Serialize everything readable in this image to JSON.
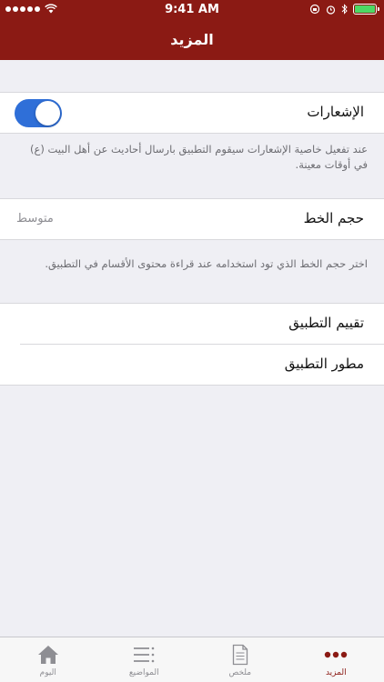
{
  "status_bar": {
    "time": "9:41 AM",
    "battery_level": 1.0,
    "icons": [
      "signal-dots-icon",
      "wifi-icon",
      "orientation-lock-icon",
      "alarm-icon",
      "bluetooth-icon",
      "battery-icon"
    ]
  },
  "nav": {
    "title": "المزيد"
  },
  "notifications": {
    "label": "الإشعارات",
    "enabled": true,
    "note": "عند تفعيل خاصية الإشعارات سيقوم التطبيق بارسال أحاديث عن أهل البيت (ع) في أوقات معينة."
  },
  "font_size": {
    "label": "حجم الخط",
    "value": "متوسط",
    "note": "اختر حجم الخط الذي تود استخدامه عند قراءة محتوى الأقسام في التطبيق."
  },
  "links": {
    "rate_app": "تقييم التطبيق",
    "developer": "مطور التطبيق"
  },
  "tabs": [
    {
      "label": "المزيد",
      "icon": "more-dots-icon",
      "active": true
    },
    {
      "label": "ملخص",
      "icon": "document-icon",
      "active": false
    },
    {
      "label": "المواضيع",
      "icon": "list-icon",
      "active": false
    },
    {
      "label": "اليوم",
      "icon": "home-icon",
      "active": false
    }
  ],
  "colors": {
    "brand": "#8b1a14",
    "toggle_on": "#2f6fd8",
    "background": "#efeff4"
  }
}
